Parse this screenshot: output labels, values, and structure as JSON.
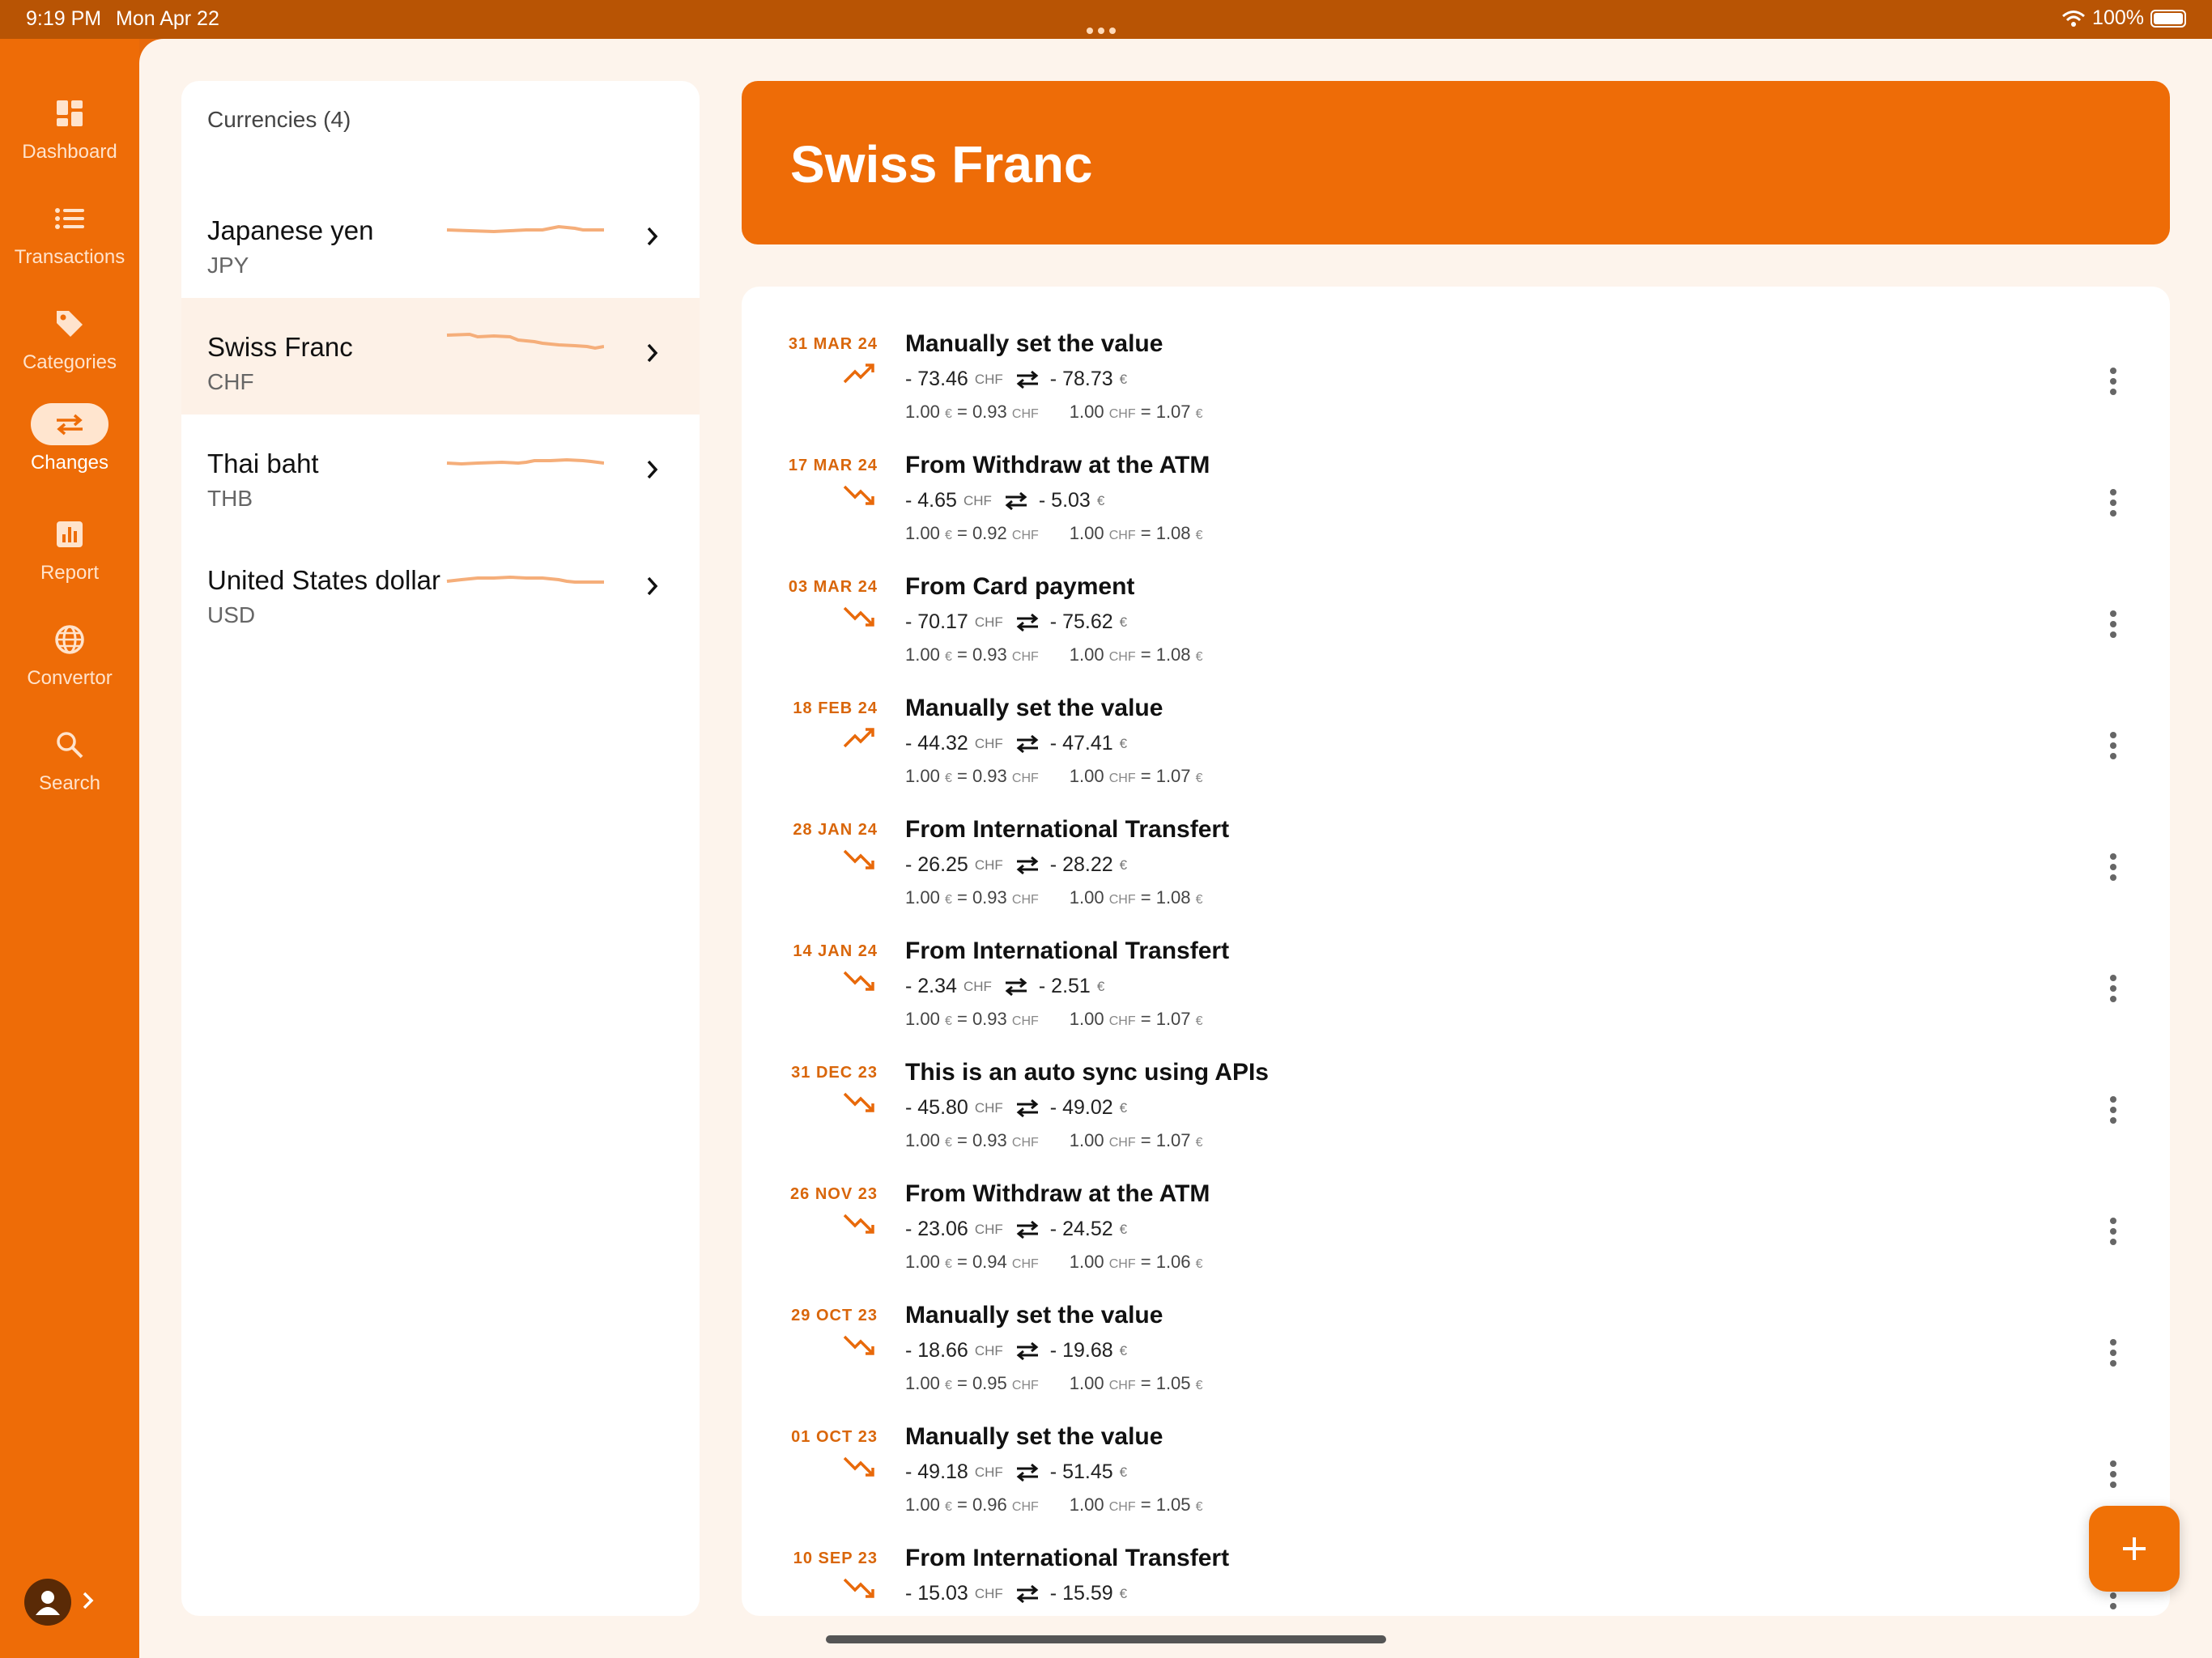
{
  "status_bar": {
    "time": "9:19 PM",
    "date": "Mon Apr 22",
    "battery": "100%"
  },
  "sidebar": {
    "items": [
      {
        "label": "Dashboard",
        "icon": "dashboard-icon"
      },
      {
        "label": "Transactions",
        "icon": "list-icon"
      },
      {
        "label": "Categories",
        "icon": "tag-icon"
      },
      {
        "label": "Changes",
        "icon": "swap-icon",
        "active": true
      },
      {
        "label": "Report",
        "icon": "report-icon"
      },
      {
        "label": "Convertor",
        "icon": "globe-icon"
      },
      {
        "label": "Search",
        "icon": "search-icon"
      }
    ]
  },
  "currencies": {
    "header": "Currencies (4)",
    "items": [
      {
        "name": "Japanese yen",
        "code": "JPY"
      },
      {
        "name": "Swiss Franc",
        "code": "CHF",
        "selected": true
      },
      {
        "name": "Thai baht",
        "code": "THB"
      },
      {
        "name": "United States dollar",
        "code": "USD"
      }
    ]
  },
  "detail": {
    "title": "Swiss Franc",
    "transactions": [
      {
        "date": "31 MAR 24",
        "trend": "up",
        "title": "Manually set the value",
        "amount_chf": "- 73.46",
        "amount_eur": "- 78.73",
        "rate_eur_chf": "0.93",
        "rate_chf_eur": "1.07"
      },
      {
        "date": "17 MAR 24",
        "trend": "down",
        "title": "From Withdraw at the ATM",
        "amount_chf": "- 4.65",
        "amount_eur": "- 5.03",
        "rate_eur_chf": "0.92",
        "rate_chf_eur": "1.08"
      },
      {
        "date": "03 MAR 24",
        "trend": "down",
        "title": "From Card payment",
        "amount_chf": "- 70.17",
        "amount_eur": "- 75.62",
        "rate_eur_chf": "0.93",
        "rate_chf_eur": "1.08"
      },
      {
        "date": "18 FEB 24",
        "trend": "up",
        "title": "Manually set the value",
        "amount_chf": "- 44.32",
        "amount_eur": "- 47.41",
        "rate_eur_chf": "0.93",
        "rate_chf_eur": "1.07"
      },
      {
        "date": "28 JAN 24",
        "trend": "down",
        "title": "From International Transfert",
        "amount_chf": "- 26.25",
        "amount_eur": "- 28.22",
        "rate_eur_chf": "0.93",
        "rate_chf_eur": "1.08"
      },
      {
        "date": "14 JAN 24",
        "trend": "down",
        "title": "From International Transfert",
        "amount_chf": "- 2.34",
        "amount_eur": "- 2.51",
        "rate_eur_chf": "0.93",
        "rate_chf_eur": "1.07"
      },
      {
        "date": "31 DEC 23",
        "trend": "down",
        "title": "This is an auto sync using APIs",
        "amount_chf": "- 45.80",
        "amount_eur": "- 49.02",
        "rate_eur_chf": "0.93",
        "rate_chf_eur": "1.07"
      },
      {
        "date": "26 NOV 23",
        "trend": "down",
        "title": "From Withdraw at the ATM",
        "amount_chf": "- 23.06",
        "amount_eur": "- 24.52",
        "rate_eur_chf": "0.94",
        "rate_chf_eur": "1.06"
      },
      {
        "date": "29 OCT 23",
        "trend": "down",
        "title": "Manually set the value",
        "amount_chf": "- 18.66",
        "amount_eur": "- 19.68",
        "rate_eur_chf": "0.95",
        "rate_chf_eur": "1.05"
      },
      {
        "date": "01 OCT 23",
        "trend": "down",
        "title": "Manually set the value",
        "amount_chf": "- 49.18",
        "amount_eur": "- 51.45",
        "rate_eur_chf": "0.96",
        "rate_chf_eur": "1.05"
      },
      {
        "date": "10 SEP 23",
        "trend": "down",
        "title": "From International Transfert",
        "amount_chf": "- 15.03",
        "amount_eur": "- 15.59",
        "rate_eur_chf": "",
        "rate_chf_eur": ""
      }
    ]
  },
  "units": {
    "chf": "CHF",
    "eur": "€",
    "one": "1.00"
  },
  "colors": {
    "accent": "#ee6c07",
    "status_bar": "#b85404",
    "trend": "#e8690a",
    "background": "#fdf4ec"
  },
  "fab": {
    "label": "+"
  }
}
